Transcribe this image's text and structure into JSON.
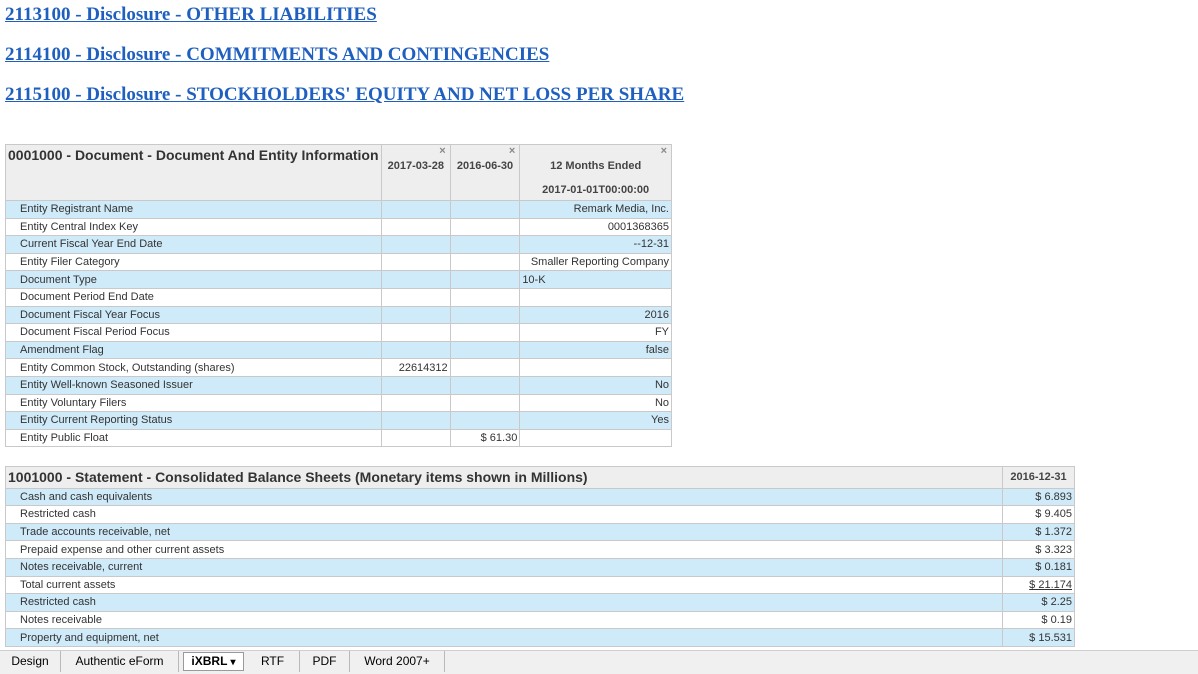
{
  "links": [
    "2113100 - Disclosure - OTHER LIABILITIES",
    "2114100 - Disclosure - COMMITMENTS AND CONTINGENCIES",
    "2115100 - Disclosure - STOCKHOLDERS' EQUITY AND NET LOSS PER SHARE"
  ],
  "doc_table": {
    "title": "0001000 - Document - Document And Entity Information",
    "col1": "2017-03-28",
    "col2": "2016-06-30",
    "col3_line1": "12 Months Ended",
    "col3_line2": "2017-01-01T00:00:00",
    "close_glyph": "×",
    "rows": [
      {
        "label": "Entity Registrant Name",
        "c1": "",
        "c2": "",
        "c3": "Remark Media, Inc."
      },
      {
        "label": "Entity Central Index Key",
        "c1": "",
        "c2": "",
        "c3": "0001368365"
      },
      {
        "label": "Current Fiscal Year End Date",
        "c1": "",
        "c2": "",
        "c3": "--12-31"
      },
      {
        "label": "Entity Filer Category",
        "c1": "",
        "c2": "",
        "c3": "Smaller Reporting Company"
      },
      {
        "label": "Document Type",
        "c1": "",
        "c2": "",
        "c3": "10-K"
      },
      {
        "label": "Document Period End Date",
        "c1": "",
        "c2": "",
        "c3": ""
      },
      {
        "label": "Document Fiscal Year Focus",
        "c1": "",
        "c2": "",
        "c3": "2016"
      },
      {
        "label": "Document Fiscal Period Focus",
        "c1": "",
        "c2": "",
        "c3": "FY"
      },
      {
        "label": "Amendment Flag",
        "c1": "",
        "c2": "",
        "c3": "false"
      },
      {
        "label": "Entity Common Stock, Outstanding (shares)",
        "c1": "22614312",
        "c2": "",
        "c3": ""
      },
      {
        "label": "Entity Well-known Seasoned Issuer",
        "c1": "",
        "c2": "",
        "c3": "No"
      },
      {
        "label": "Entity Voluntary Filers",
        "c1": "",
        "c2": "",
        "c3": "No"
      },
      {
        "label": "Entity Current Reporting Status",
        "c1": "",
        "c2": "",
        "c3": "Yes"
      },
      {
        "label": "Entity Public Float",
        "c1": "",
        "c2": "$ 61.30",
        "c3": ""
      }
    ]
  },
  "bs_table": {
    "title": "1001000 - Statement - Consolidated Balance Sheets (Monetary items shown in Millions)",
    "col1": "2016-12-31",
    "rows": [
      {
        "label": "Cash and cash equivalents",
        "value": "$ 6.893"
      },
      {
        "label": "Restricted cash",
        "value": "$ 9.405"
      },
      {
        "label": "Trade accounts receivable, net",
        "value": "$ 1.372"
      },
      {
        "label": "Prepaid expense and other current assets",
        "value": "$ 3.323"
      },
      {
        "label": "Notes receivable, current",
        "value": "$ 0.181"
      },
      {
        "label": "Total current assets",
        "value": "$ 21.174"
      },
      {
        "label": "Restricted cash",
        "value": "$ 2.25"
      },
      {
        "label": "Notes receivable",
        "value": "$ 0.19"
      },
      {
        "label": "Property and equipment, net",
        "value": "$ 15.531"
      }
    ]
  },
  "tabs": {
    "design": "Design",
    "authentic": "Authentic eForm",
    "ixbrl": "iXBRL",
    "ixbrl_arrow": "▾",
    "rtf": "RTF",
    "pdf": "PDF",
    "word": "Word 2007+"
  }
}
